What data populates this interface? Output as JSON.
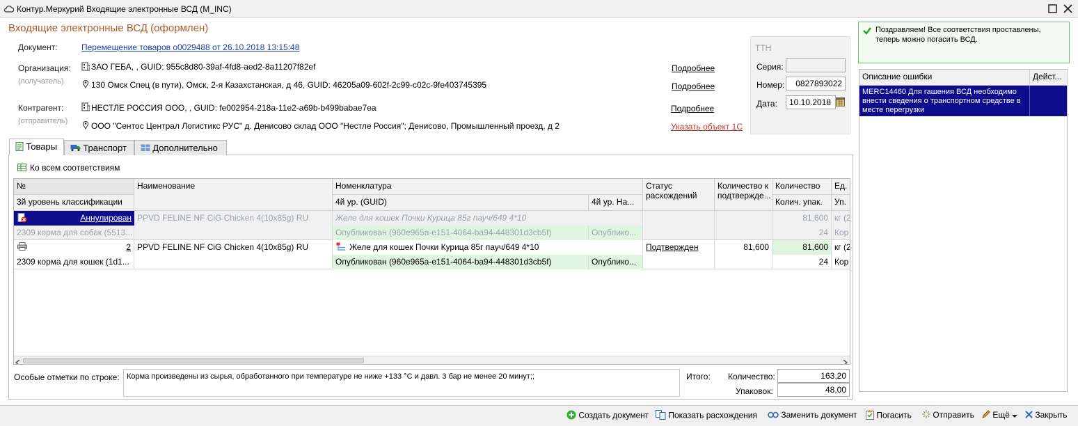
{
  "window": {
    "title": "Контур.Меркурий Входящие электронные ВСД (M_INC)"
  },
  "header": {
    "title": "Входящие электронные ВСД (оформлен)"
  },
  "document": {
    "label": "Документ:",
    "link": "Перемещение товаров o0029488 от 26.10.2018 13:15:48"
  },
  "organization": {
    "label": "Организация:",
    "sublabel": "(получатель)",
    "line1": "ЗАО ГЕБА, , GUID: 955c8d80-39af-4fd8-aed2-8a11207f82ef",
    "line2": "130 Омск Спец (в пути), Омск, 2-я Казахстанская, д 46, GUID: 46205a09-602f-2c99-c02c-9fe403745395",
    "more1": "Подробнее",
    "more2": "Подробнее"
  },
  "counterparty": {
    "label": "Контрагент:",
    "sublabel": "(отправитель)",
    "line1": "НЕСТЛЕ РОССИЯ ООО, , GUID: fe002954-218a-11e2-a69b-b499babae7ea",
    "line2": "ООО \"Сентос Централ Логистикс РУС\" д. Денисово склад ООО \"Нестле Россия\"; Денисово, Промышленный проезд, д 2",
    "more": "Подробнее",
    "specify": "Указать объект 1С"
  },
  "ttn": {
    "title": "ТТН",
    "series_label": "Серия:",
    "series_value": "",
    "number_label": "Номер:",
    "number_value": "0827893022",
    "date_label": "Дата:",
    "date_value": "10.10.2018"
  },
  "notice": {
    "text": "Поздравляем! Все соответствия проставлены, теперь можно погасить ВСД."
  },
  "errors": {
    "col_desc": "Описание ошибки",
    "col_action": "Дейст...",
    "row_text": "MERC14460 Для гашения ВСД необходимо внести сведения о транспортном средстве в месте перегрузки"
  },
  "tabs": [
    "Товары",
    "Транспорт",
    "Дополнительно"
  ],
  "to_all": "Ко всем соответствиям",
  "grid": {
    "headers": {
      "num": "№",
      "class3": "3й уровень классификации",
      "name": "Наименование",
      "nomen": "Номенклатура",
      "guid4": "4й ур. (GUID)",
      "name4": "4й ур. На...",
      "status": "Статус расхождений",
      "qty_conf": "Количество к подтвержде...",
      "qty": "Количество",
      "qty_pack": "Колич. упак.",
      "unit": "Ед. и",
      "unit2": "Уп."
    },
    "rows": [
      {
        "num": "Аннулирован",
        "class3": "2309 корма для собак (5513...",
        "name": "PPVD FELINE NF CiG Chicken 4(10x85g) RU",
        "nomen": "Желе для кошек Почки Курица 85г пауч/649 4*10",
        "guid": "Опубликован (960e965a-e151-4064-ba94-448301d3cb5f)",
        "name4": "Опублико...",
        "status": "",
        "qty_conf": "",
        "qty": "81,600",
        "pack": "24",
        "unit": "кг (2",
        "unit2": "Кор"
      },
      {
        "num": "2",
        "class3": "2309 корма для кошек (1d1...",
        "name": "PPVD FELINE NF CiG Chicken 4(10x85g) RU",
        "nomen": "Желе для кошек Почки Курица 85г пауч/649 4*10",
        "guid": "Опубликован (960e965a-e151-4064-ba94-448301d3cb5f)",
        "name4": "Опублико...",
        "status": "Подтвержден",
        "qty_conf": "81,600",
        "qty": "81,600",
        "pack": "24",
        "unit": "кг (2",
        "unit2": "Кор"
      }
    ]
  },
  "footer": {
    "notes_label": "Особые отметки по строке:",
    "notes_value": "Корма произведены из сырья, обработанного при температуре не ниже +133 °С и давл. 3 бар не менее 20 минут;;",
    "total_label": "Итого:",
    "qty_label": "Количество:",
    "qty_value": "163,20",
    "pack_label": "Упаковок:",
    "pack_value": "48,00"
  },
  "actions": {
    "create": "Создать документ",
    "diffs": "Показать расхождения",
    "replace": "Заменить документ",
    "redeem": "Погасить",
    "send": "Отправить",
    "more": "Ещё",
    "close": "Закрыть"
  }
}
